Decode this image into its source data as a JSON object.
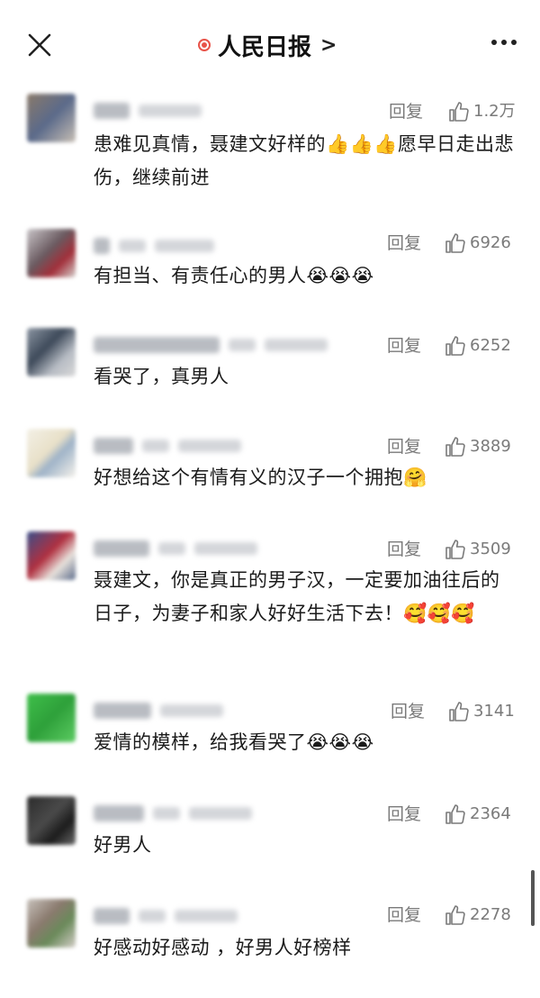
{
  "header": {
    "title": "人民日报",
    "title_arrow": ">",
    "close_icon": "close-icon",
    "more_icon": "more-icon",
    "live_dot_color": "#e8544a"
  },
  "reply_label": "回复",
  "comments": [
    {
      "likes": "1.2万",
      "text": "患难见真情，聂建文好样的👍👍👍愿早日走出悲伤，继续前进"
    },
    {
      "likes": "6926",
      "text": "有担当、有责任心的男人😭😭😭"
    },
    {
      "likes": "6252",
      "text": "看哭了，真男人"
    },
    {
      "likes": "3889",
      "text": "好想给这个有情有义的汉子一个拥抱🤗"
    },
    {
      "likes": "3509",
      "text": "聂建文，你是真正的男子汉，一定要加油往后的日子，为妻子和家人好好生活下去！🥰🥰🥰"
    },
    {
      "likes": "3141",
      "text": "爱情的模样，给我看哭了😭😭😭"
    },
    {
      "likes": "2364",
      "text": "好男人"
    },
    {
      "likes": "2278",
      "text": "好感动好感动 ，好男人好榜样"
    }
  ],
  "colors": {
    "meta_text": "#7a7a7a",
    "body_text": "#1b1b1b"
  }
}
